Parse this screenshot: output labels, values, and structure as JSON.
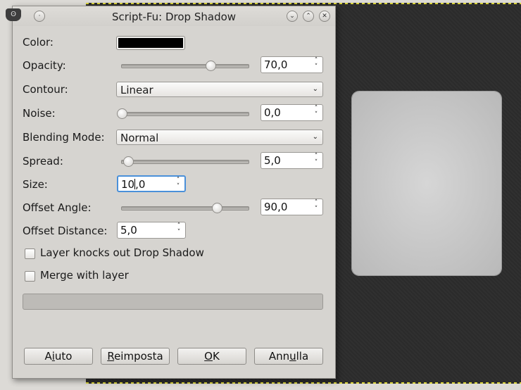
{
  "dialog": {
    "title": "Script-Fu: Drop Shadow",
    "buttons": {
      "help": {
        "pre": "A",
        "key": "i",
        "post": "uto"
      },
      "reset": {
        "pre": "",
        "key": "R",
        "post": "eimposta"
      },
      "ok": {
        "pre": "",
        "key": "O",
        "post": "K"
      },
      "cancel": {
        "pre": "Ann",
        "key": "u",
        "post": "lla"
      }
    }
  },
  "fields": {
    "color": {
      "label": "Color:",
      "value": "#000000"
    },
    "opacity": {
      "label": "Opacity:",
      "value": "70,0",
      "slider_fraction": 0.7
    },
    "contour": {
      "label": "Contour:",
      "value": "Linear"
    },
    "noise": {
      "label": "Noise:",
      "value": "0,0",
      "slider_fraction": 0.0
    },
    "blending_mode": {
      "label": "Blending Mode:",
      "value": "Normal"
    },
    "spread": {
      "label": "Spread:",
      "value": "5,0",
      "slider_fraction": 0.05
    },
    "size": {
      "label": "Size:",
      "value_before_caret": "10",
      "value_after_caret": ",0"
    },
    "offset_angle": {
      "label": "Offset Angle:",
      "value": "90,0",
      "slider_fraction": 0.75
    },
    "offset_distance": {
      "label": "Offset Distance:",
      "value": "5,0"
    }
  },
  "checkboxes": {
    "layer_knocks_out": {
      "label": "Layer knocks out Drop Shadow",
      "checked": false
    },
    "merge_with_layer": {
      "label": "Merge with layer",
      "checked": false
    }
  },
  "icons": {
    "app": "gimp-icon",
    "arrows": "spin-arrows-icon",
    "dropdown": "chevron-down-icon"
  },
  "colors": {
    "canvas_bg": "#2b2b2b",
    "dialog_bg": "#d6d4d0",
    "selection_border": "#4a90d9"
  }
}
